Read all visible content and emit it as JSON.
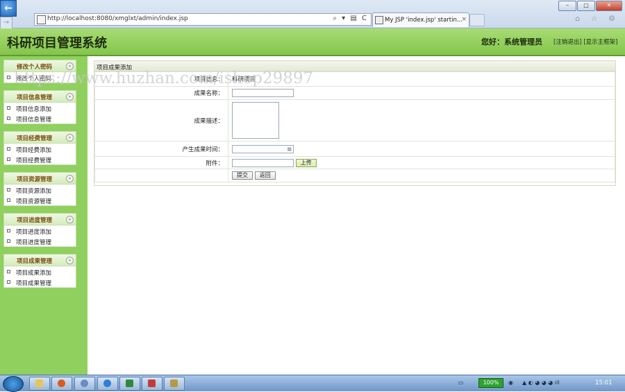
{
  "browser": {
    "url": "http://localhost:8080/xmglxt/admin/index.jsp",
    "tab_title": "My JSP 'index.jsp' startin...",
    "tab_close": "×",
    "min_label": "–",
    "max_label": "□",
    "close_label": "✕",
    "search_tools": "⌕ ▾ ▤ C",
    "right_icons": "⌂ ☆ ⚙"
  },
  "header": {
    "title": "科研项目管理系统",
    "greeting": "您好：系统管理员",
    "logout": "[注销退出]",
    "home": "[显示主框架]"
  },
  "sidebar": {
    "groups": [
      {
        "title": "修改个人密码",
        "items": [
          "修改个人密码"
        ]
      },
      {
        "title": "项目信息管理",
        "items": [
          "项目信息添加",
          "项目信息管理"
        ]
      },
      {
        "title": "项目经费管理",
        "items": [
          "项目经费添加",
          "项目经费管理"
        ]
      },
      {
        "title": "项目资源管理",
        "items": [
          "项目资源添加",
          "项目资源管理"
        ]
      },
      {
        "title": "项目进度管理",
        "items": [
          "项目进度添加",
          "项目进度管理"
        ]
      },
      {
        "title": "项目成果管理",
        "items": [
          "项目成果添加",
          "项目成果管理"
        ]
      }
    ],
    "toggle_icon": "»"
  },
  "form": {
    "panel_title": "项目成果添加",
    "project_label": "项目信息：",
    "project_value": "科研项目",
    "name_label": "成果名称：",
    "name_value": "",
    "desc_label": "成果描述：",
    "desc_value": "",
    "time_label": "产生成果时间：",
    "time_value": "",
    "attach_label": "附件：",
    "attach_value": "",
    "upload_button": "上传",
    "submit_button": "提交",
    "back_button": "返回"
  },
  "watermark": "https://www.huzhan.com/ishop29897",
  "taskbar": {
    "battery": "100%",
    "clock": "15:01",
    "tray_icons": "▲ ◐ ◕ ◕ ◕ ıll"
  }
}
